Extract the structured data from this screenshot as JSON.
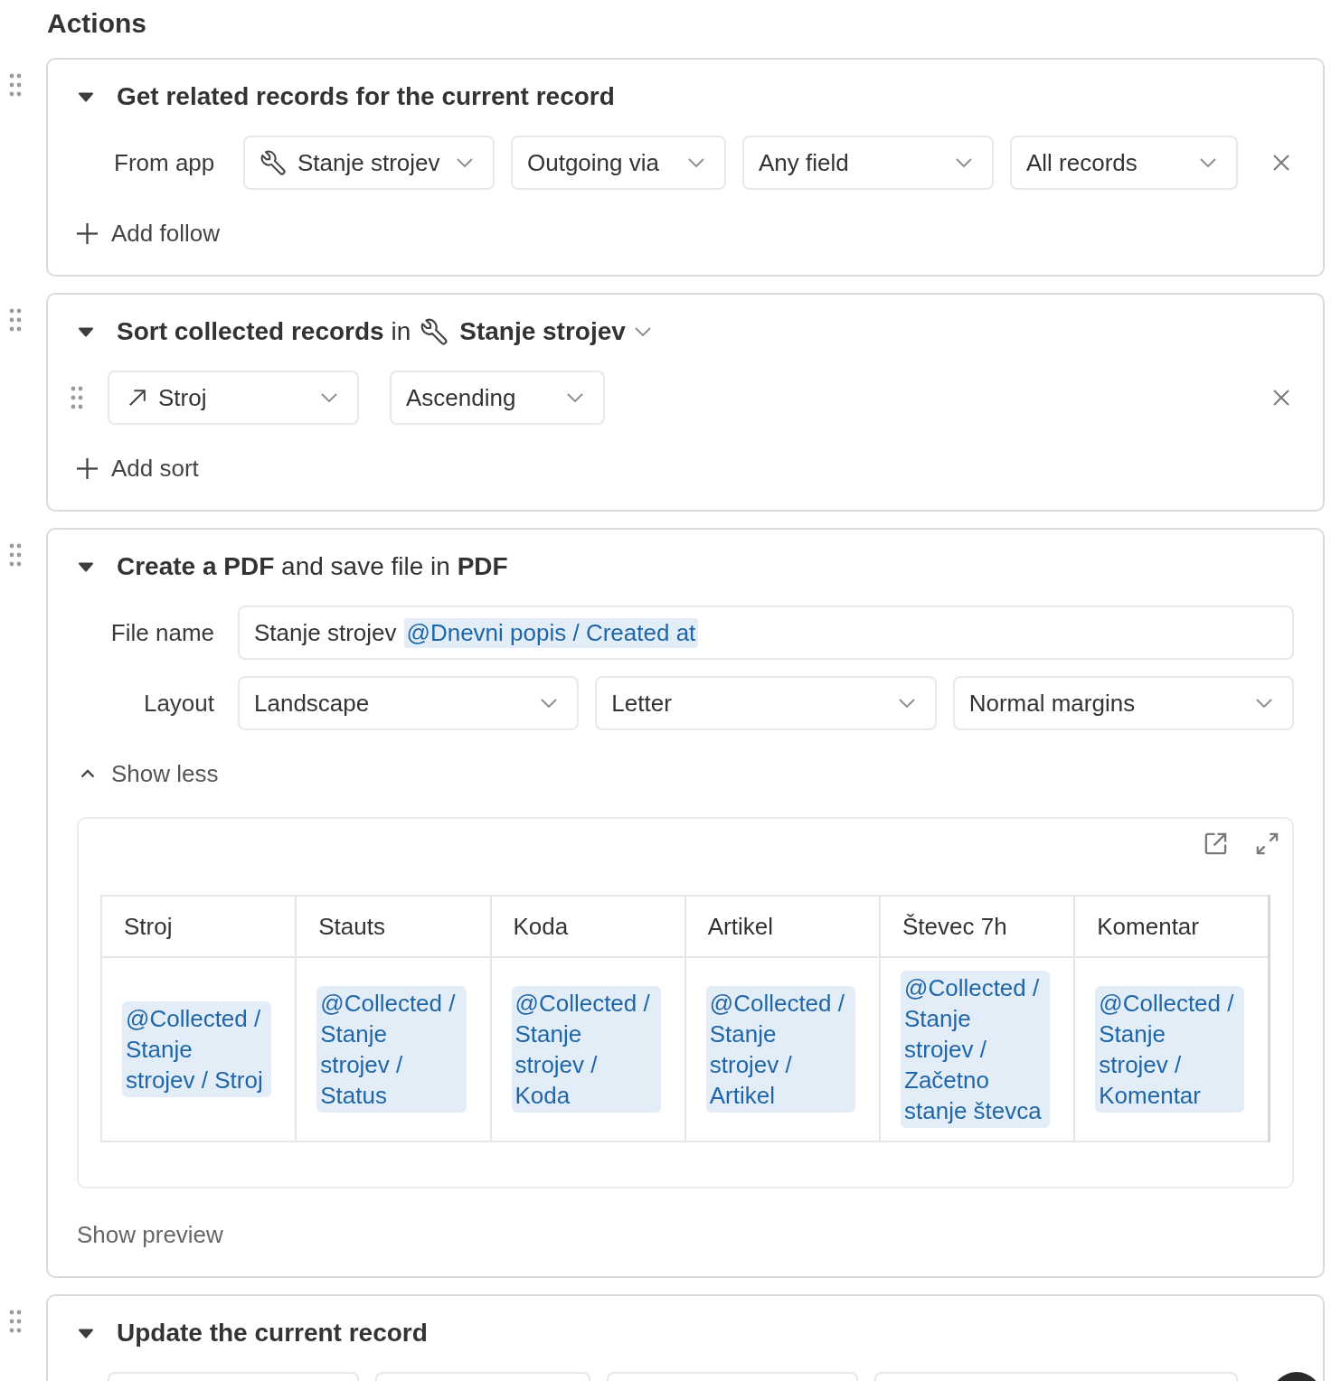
{
  "heading": "Actions",
  "actions": [
    {
      "kind": "related",
      "expanded": true,
      "title": "Get related records for the current record",
      "row_label": "From app",
      "selects": [
        {
          "kind": "app",
          "value": "Stanje strojev"
        },
        {
          "kind": "plain",
          "value": "Outgoing via"
        },
        {
          "kind": "plain",
          "value": "Any field"
        },
        {
          "kind": "plain",
          "value": "All records"
        }
      ],
      "add_label": "Add follow"
    },
    {
      "kind": "sort",
      "expanded": true,
      "title": "**Sort collected records** in",
      "app": "Stanje strojev",
      "selects": [
        {
          "kind": "field",
          "value": "Stroj"
        },
        {
          "kind": "plain",
          "value": "Ascending"
        }
      ],
      "add_label": "Add sort"
    },
    {
      "kind": "pdf",
      "expanded": true,
      "title": "**Create a PDF** and save file in **PDF**",
      "file_name": {
        "label": "File name",
        "parts": [
          {
            "kind": "text",
            "text": "Stanje strojev"
          },
          {
            "kind": "token",
            "text": "@Dnevni popis / Created at"
          }
        ]
      },
      "layout": {
        "label": "Layout",
        "selects": [
          {
            "value": "Landscape"
          },
          {
            "value": "Letter"
          },
          {
            "value": "Normal margins"
          }
        ]
      },
      "toggle": {
        "label": "Show less",
        "expanded": true
      },
      "preview": {
        "columns": [
          "Stroj",
          "Stauts",
          "Koda",
          "Artikel",
          "Števec 7h",
          "Komentar"
        ],
        "rows": [
          [
            "@Collected / Stanje strojev / Stroj",
            "@Collected / Stanje strojev / Status",
            "@Collected / Stanje strojev / Koda",
            "@Collected / Stanje strojev / Artikel",
            "@Collected / Stanje strojev / Začetno stanje števca",
            "@Collected / Stanje strojev / Komentar"
          ]
        ]
      },
      "preview_label": "Show preview"
    },
    {
      "kind": "update",
      "expanded": true,
      "title": "Update the current record",
      "selects": [
        {
          "kind": "plain"
        },
        {
          "kind": "plain"
        },
        {
          "kind": "plain"
        },
        {
          "kind": "plain"
        }
      ]
    }
  ]
}
